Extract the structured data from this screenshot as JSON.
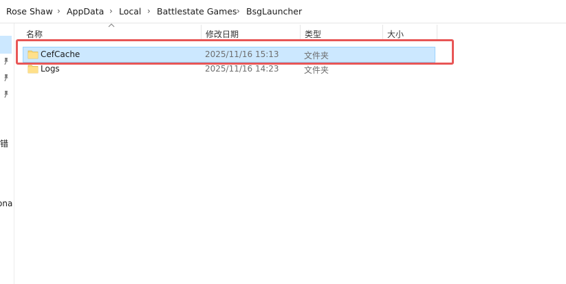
{
  "breadcrumb": [
    {
      "label": "Rose Shaw"
    },
    {
      "label": "AppData"
    },
    {
      "label": "Local"
    },
    {
      "label": "Battlestate Games"
    },
    {
      "label": "BsgLauncher"
    }
  ],
  "breadcrumb_separator": "›",
  "nav": {
    "partial_labels": [
      "报错",
      "ona"
    ]
  },
  "columns": {
    "name": "名称",
    "date": "修改日期",
    "type": "类型",
    "size": "大小"
  },
  "files": [
    {
      "name": "CefCache",
      "date": "2025/11/16 15:13",
      "type": "文件夹",
      "selected": true
    },
    {
      "name": "Logs",
      "date": "2025/11/16 14:23",
      "type": "文件夹",
      "selected": false
    }
  ],
  "colors": {
    "selection": "#cce8ff",
    "selection_border": "#99d1ff",
    "annotation": "#e85656",
    "folder": "#f8d775"
  },
  "icons": [
    "pin-icon",
    "folder-icon",
    "sort-ascending-icon"
  ]
}
